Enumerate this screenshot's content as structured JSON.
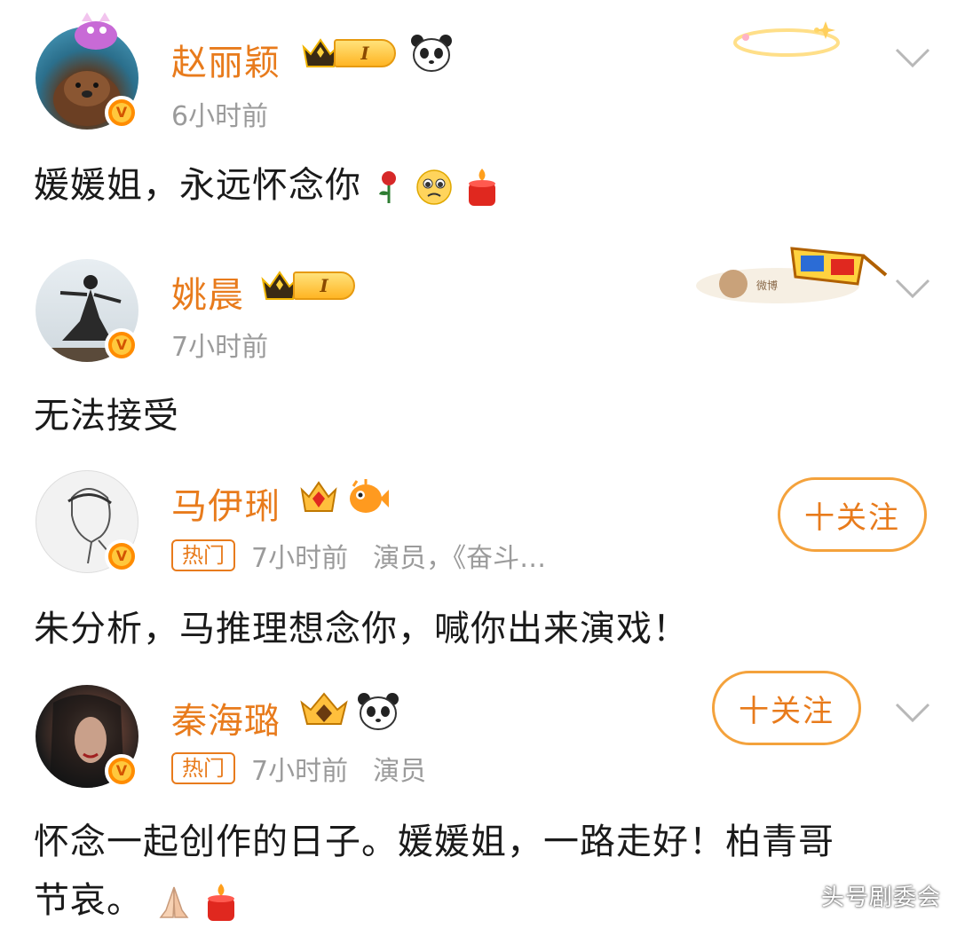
{
  "comments": [
    {
      "username": "赵丽颖",
      "level": "I",
      "time": "6小时前",
      "content": "媛媛姐，永远怀念你",
      "content_emojis": [
        "rose-emoji",
        "pleading-face-emoji",
        "candle-emoji"
      ],
      "badges": [
        "crown-badge",
        "panda-badge"
      ]
    },
    {
      "username": "姚晨",
      "level": "I",
      "time": "7小时前",
      "content": "无法接受",
      "badges": [
        "crown-badge"
      ]
    },
    {
      "username": "马伊琍",
      "hot_tag": "热门",
      "time": "7小时前",
      "description": "演员，《奋斗…",
      "follow_label": "十关注",
      "content": "朱分析，马推理想念你，喊你出来演戏！",
      "badges": [
        "gem-crown-badge",
        "fish-badge"
      ]
    },
    {
      "username": "秦海璐",
      "hot_tag": "热门",
      "time": "7小时前",
      "description": "演员",
      "follow_label": "十关注",
      "content_line1": "怀念一起创作的日子。媛媛姐，一路走好！柏青哥",
      "content_line2": "节哀。",
      "content_emojis": [
        "praying-hands-emoji",
        "candle-emoji"
      ],
      "badges": [
        "gem-crown-badge",
        "panda-badge"
      ]
    }
  ],
  "watermark": "头号剧委会",
  "colors": {
    "username": "#e87b1c",
    "meta": "#9b9b9b",
    "follow_border": "#f4a23c",
    "verified": "#ff8c00"
  }
}
